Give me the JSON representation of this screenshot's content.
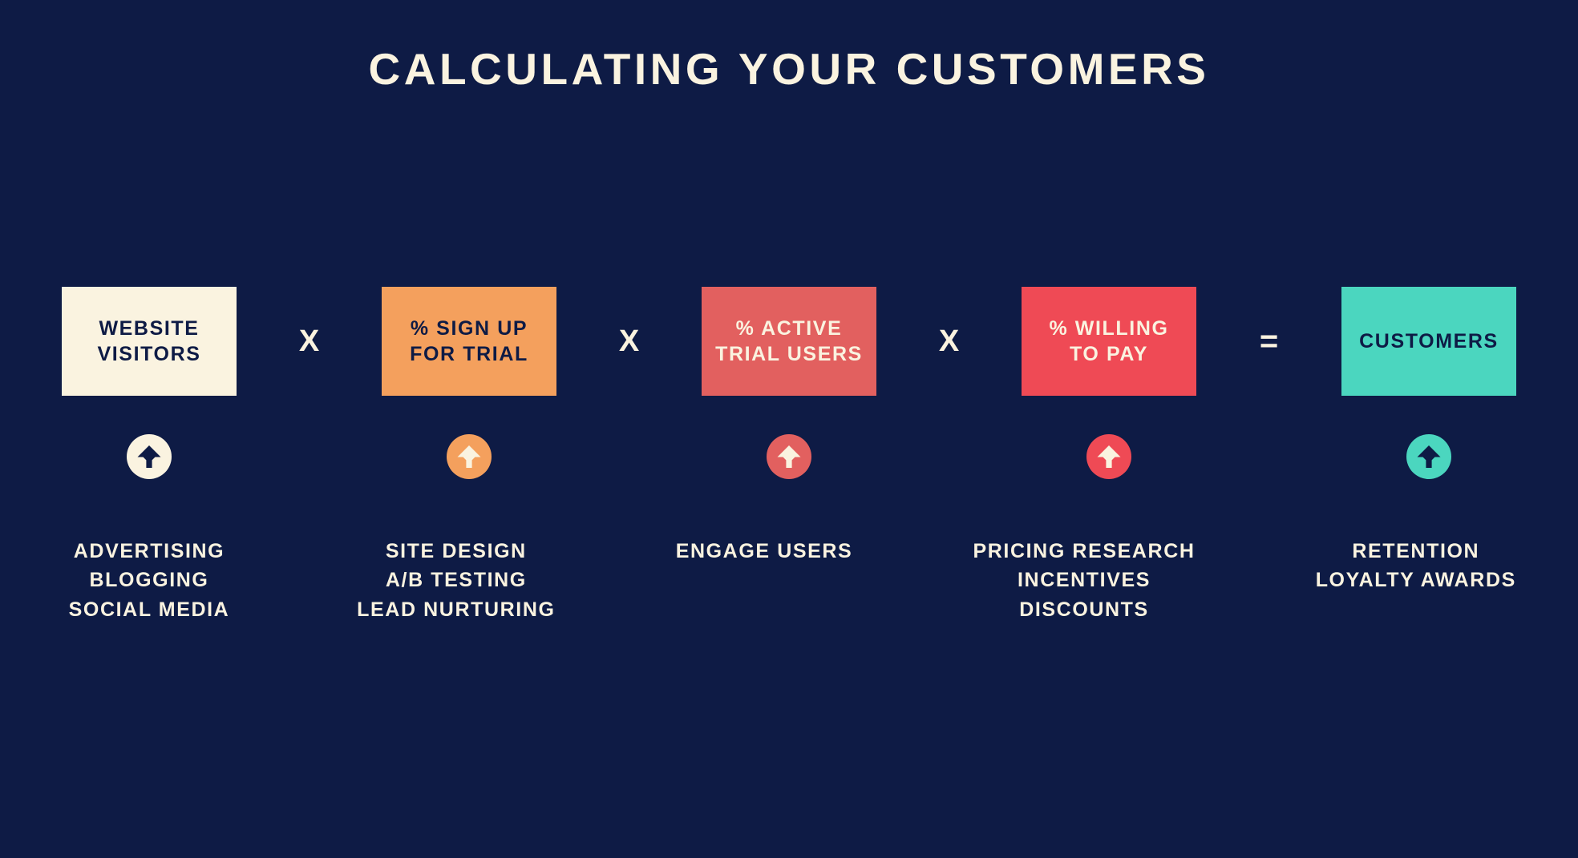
{
  "page": {
    "title": "CALCULATING YOUR CUSTOMERS",
    "background_color": "#0e1b45",
    "cream_color": "#faf3e0"
  },
  "formula": {
    "stages": [
      {
        "id": "website-visitors",
        "label": "WEBSITE\nVISITORS",
        "box_color": "#faf3e0",
        "text_color": "#0e1b45",
        "operator_after": "X",
        "icon": "arrow-up-circle-icon",
        "icon_circle_color": "#faf3e0",
        "icon_arrow_color": "#0e1b45",
        "caption_lines": [
          "ADVERTISING",
          "BLOGGING",
          "SOCIAL MEDIA"
        ]
      },
      {
        "id": "percent-sign-up-for-trial",
        "label": "% SIGN UP\nFOR TRIAL",
        "box_color": "#f4a05d",
        "text_color": "#0e1b45",
        "operator_after": "X",
        "icon": "arrow-up-circle-icon",
        "icon_circle_color": "#f4a05d",
        "icon_arrow_color": "#faf3e0",
        "caption_lines": [
          "SITE DESIGN",
          "A/B TESTING",
          "LEAD NURTURING"
        ]
      },
      {
        "id": "percent-active-trial-users",
        "label": "% ACTIVE\nTRIAL USERS",
        "box_color": "#e2605f",
        "text_color": "#faf3e0",
        "operator_after": "X",
        "icon": "arrow-up-circle-icon",
        "icon_circle_color": "#e2605f",
        "icon_arrow_color": "#faf3e0",
        "caption_lines": [
          "ENGAGE USERS"
        ]
      },
      {
        "id": "percent-willing-to-pay",
        "label": "% WILLING\nTO PAY",
        "box_color": "#ef4a55",
        "text_color": "#faf3e0",
        "operator_after": "=",
        "icon": "arrow-up-circle-icon",
        "icon_circle_color": "#ef4a55",
        "icon_arrow_color": "#faf3e0",
        "caption_lines": [
          "PRICING RESEARCH",
          "INCENTIVES",
          "DISCOUNTS"
        ]
      },
      {
        "id": "customers",
        "label": "CUSTOMERS",
        "box_color": "#4bd6bf",
        "text_color": "#0e1b45",
        "operator_after": "",
        "icon": "arrow-up-circle-icon",
        "icon_circle_color": "#4bd6bf",
        "icon_arrow_color": "#0e1b45",
        "caption_lines": [
          "RETENTION",
          "LOYALTY AWARDS"
        ]
      }
    ]
  },
  "chart_data": {
    "type": "diagram",
    "title": "CALCULATING YOUR CUSTOMERS",
    "equation": "WEBSITE VISITORS X % SIGN UP FOR TRIAL X % ACTIVE TRIAL USERS X % WILLING TO PAY = CUSTOMERS",
    "terms": [
      "WEBSITE VISITORS",
      "% SIGN UP FOR TRIAL",
      "% ACTIVE TRIAL USERS",
      "% WILLING TO PAY",
      "CUSTOMERS"
    ],
    "operators": [
      "X",
      "X",
      "X",
      "="
    ],
    "levers": [
      [
        "ADVERTISING",
        "BLOGGING",
        "SOCIAL MEDIA"
      ],
      [
        "SITE DESIGN",
        "A/B TESTING",
        "LEAD NURTURING"
      ],
      [
        "ENGAGE USERS"
      ],
      [
        "PRICING RESEARCH",
        "INCENTIVES",
        "DISCOUNTS"
      ],
      [
        "RETENTION",
        "LOYALTY AWARDS"
      ]
    ]
  }
}
